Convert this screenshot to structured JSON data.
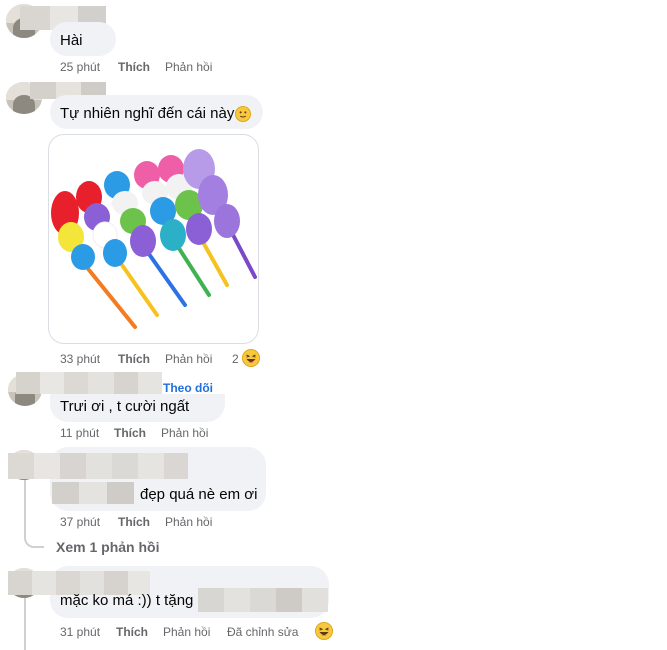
{
  "comments": [
    {
      "text": "Hài",
      "time": "25 phút",
      "like": "Thích",
      "reply": "Phản hồi"
    },
    {
      "text": "Tự nhiên nghĩ đến cái này",
      "time": "33 phút",
      "like": "Thích",
      "reply": "Phản hồi",
      "reaction_count": "2"
    },
    {
      "text": "Trưi ơi , t cười ngất",
      "time": "11 phút",
      "like": "Thích",
      "reply": "Phản hồi",
      "follow": "Theo dõi"
    },
    {
      "text": "đẹp quá nè em ơi",
      "time": "37 phút",
      "like": "Thích",
      "reply": "Phản hồi",
      "view_replies": "Xem 1 phản hồi"
    },
    {
      "text": "mặc ko má :)) t tặng l",
      "time": "31 phút",
      "like": "Thích",
      "reply": "Phản hồi",
      "edited": "Đã chỉnh sửa"
    }
  ],
  "icons": [
    "avatar",
    "slightly-smiling-emoji-icon",
    "haha-reaction-icon",
    "feather-duster-image"
  ],
  "colors": {
    "bubble": "#f0f2f5",
    "meta": "#65676b",
    "follow": "#216fdb",
    "text": "#050505"
  }
}
